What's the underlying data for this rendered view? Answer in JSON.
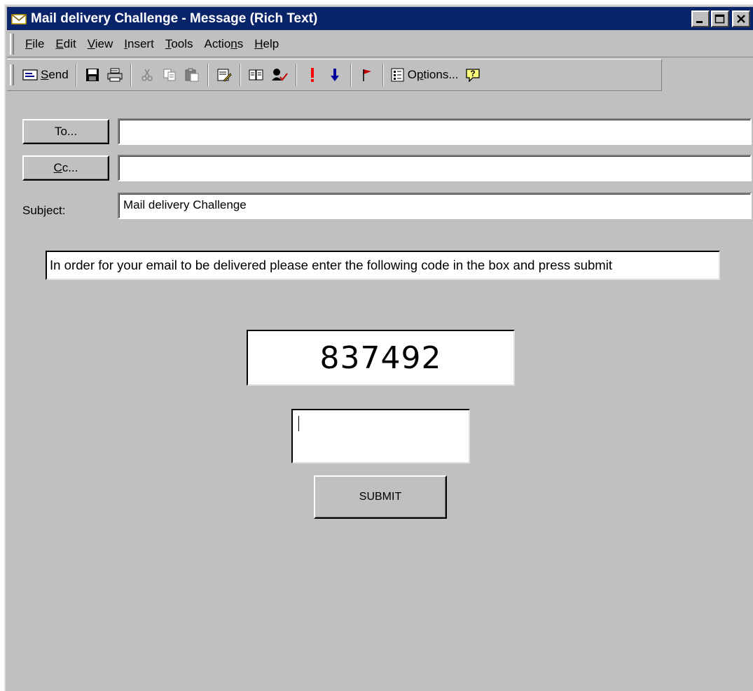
{
  "window": {
    "title": "Mail delivery Challenge - Message (Rich Text)"
  },
  "menubar": {
    "items": [
      {
        "pre": "",
        "key": "F",
        "post": "ile"
      },
      {
        "pre": "",
        "key": "E",
        "post": "dit"
      },
      {
        "pre": "",
        "key": "V",
        "post": "iew"
      },
      {
        "pre": "",
        "key": "I",
        "post": "nsert"
      },
      {
        "pre": "",
        "key": "T",
        "post": "ools"
      },
      {
        "pre": "Actio",
        "key": "n",
        "post": "s"
      },
      {
        "pre": "",
        "key": "H",
        "post": "elp"
      }
    ]
  },
  "toolbar": {
    "send": {
      "key": "S",
      "post": "end"
    },
    "options": {
      "pre": "O",
      "key": "p",
      "post": "tions..."
    }
  },
  "header": {
    "to_button": "To...",
    "cc_button": {
      "key": "C",
      "post": "c..."
    },
    "to_value": "",
    "cc_value": "",
    "subject_label": {
      "pre": "Sub",
      "key": "j",
      "post": "ect:"
    },
    "subject_value": "Mail delivery Challenge"
  },
  "body": {
    "notice": "In order for your email to be delivered please enter the following code in the box and press submit",
    "code": "837492",
    "input_value": "",
    "submit_label": "SUBMIT"
  },
  "colors": {
    "titlebar": "#0a246a",
    "face": "#c0c0c0",
    "importance_high": "#ff0000",
    "importance_low": "#00009c",
    "flag": "#c00000"
  }
}
